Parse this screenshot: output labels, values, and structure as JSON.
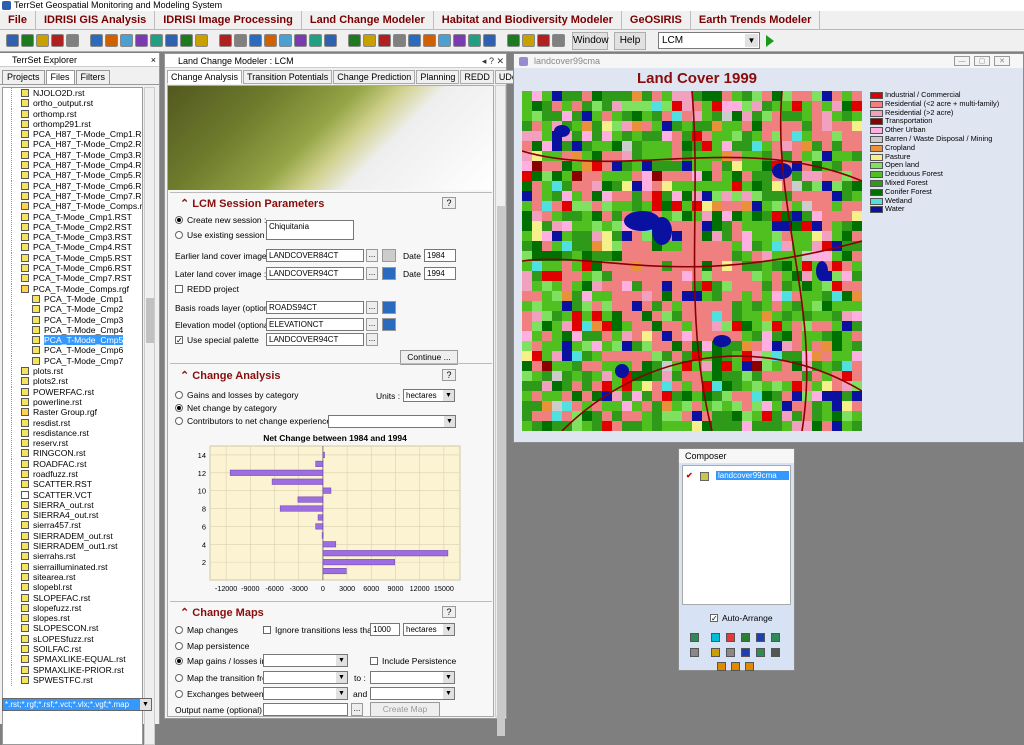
{
  "app": {
    "title": "TerrSet Geospatial Monitoring and Modeling System"
  },
  "menu": [
    "File",
    "IDRISI GIS Analysis",
    "IDRISI Image Processing",
    "Land Change Modeler",
    "Habitat and Biodiversity Modeler",
    "GeOSIRIS",
    "Earth Trends Modeler"
  ],
  "toolbar": {
    "window_label": "Window",
    "help_label": "Help",
    "module_select": "LCM"
  },
  "explorer": {
    "title": "TerrSet Explorer",
    "tabs": [
      "Projects",
      "Files",
      "Filters"
    ],
    "files": [
      {
        "name": "NJOLO2D.rst",
        "level": 1
      },
      {
        "name": "ortho_output.rst",
        "level": 1
      },
      {
        "name": "orthomp.rst",
        "level": 1
      },
      {
        "name": "orthomp291.rst",
        "level": 1
      },
      {
        "name": "PCA_H87_T-Mode_Cmp1.RST",
        "level": 1
      },
      {
        "name": "PCA_H87_T-Mode_Cmp2.RST",
        "level": 1
      },
      {
        "name": "PCA_H87_T-Mode_Cmp3.RST",
        "level": 1
      },
      {
        "name": "PCA_H87_T-Mode_Cmp4.RST",
        "level": 1
      },
      {
        "name": "PCA_H87_T-Mode_Cmp5.RST",
        "level": 1
      },
      {
        "name": "PCA_H87_T-Mode_Cmp6.RST",
        "level": 1
      },
      {
        "name": "PCA_H87_T-Mode_Cmp7.RST",
        "level": 1
      },
      {
        "name": "PCA_H87_T-Mode_Comps.rgf",
        "level": 1
      },
      {
        "name": "PCA_T-Mode_Cmp1.RST",
        "level": 1
      },
      {
        "name": "PCA_T-Mode_Cmp2.RST",
        "level": 1
      },
      {
        "name": "PCA_T-Mode_Cmp3.RST",
        "level": 1
      },
      {
        "name": "PCA_T-Mode_Cmp4.RST",
        "level": 1
      },
      {
        "name": "PCA_T-Mode_Cmp5.RST",
        "level": 1
      },
      {
        "name": "PCA_T-Mode_Cmp6.RST",
        "level": 1
      },
      {
        "name": "PCA_T-Mode_Cmp7.RST",
        "level": 1
      },
      {
        "name": "PCA_T-Mode_Comps.rgf",
        "level": 1
      },
      {
        "name": "PCA_T-Mode_Cmp1",
        "level": 2
      },
      {
        "name": "PCA_T-Mode_Cmp2",
        "level": 2
      },
      {
        "name": "PCA_T-Mode_Cmp3",
        "level": 2
      },
      {
        "name": "PCA_T-Mode_Cmp4",
        "level": 2
      },
      {
        "name": "PCA_T-Mode_Cmp5",
        "level": 2,
        "selected": true
      },
      {
        "name": "PCA_T-Mode_Cmp6",
        "level": 2
      },
      {
        "name": "PCA_T-Mode_Cmp7",
        "level": 2
      },
      {
        "name": "plots.rst",
        "level": 1
      },
      {
        "name": "plots2.rst",
        "level": 1
      },
      {
        "name": "POWERFAC.rst",
        "level": 1
      },
      {
        "name": "powerline.rst",
        "level": 1
      },
      {
        "name": "Raster Group.rgf",
        "level": 1
      },
      {
        "name": "resdist.rst",
        "level": 1
      },
      {
        "name": "resdistance.rst",
        "level": 1
      },
      {
        "name": "reserv.rst",
        "level": 1
      },
      {
        "name": "RINGCON.rst",
        "level": 1
      },
      {
        "name": "ROADFAC.rst",
        "level": 1
      },
      {
        "name": "roadfuzz.rst",
        "level": 1
      },
      {
        "name": "SCATTER.RST",
        "level": 1
      },
      {
        "name": "SCATTER.VCT",
        "level": 1
      },
      {
        "name": "SIERRA_out.rst",
        "level": 1
      },
      {
        "name": "SIERRA4_out.rst",
        "level": 1
      },
      {
        "name": "sierra457.rst",
        "level": 1
      },
      {
        "name": "SIERRADEM_out.rst",
        "level": 1
      },
      {
        "name": "SIERRADEM_out1.rst",
        "level": 1
      },
      {
        "name": "sierrahs.rst",
        "level": 1
      },
      {
        "name": "sierrailluminated.rst",
        "level": 1
      },
      {
        "name": "sitearea.rst",
        "level": 1
      },
      {
        "name": "slopebl.rst",
        "level": 1
      },
      {
        "name": "SLOPEFAC.rst",
        "level": 1
      },
      {
        "name": "slopefuzz.rst",
        "level": 1
      },
      {
        "name": "slopes.rst",
        "level": 1
      },
      {
        "name": "SLOPESCON.rst",
        "level": 1
      },
      {
        "name": "sLOPESfuzz.rst",
        "level": 1
      },
      {
        "name": "SOILFAC.rst",
        "level": 1
      },
      {
        "name": "SPMAXLIKE-EQUAL.rst",
        "level": 1
      },
      {
        "name": "SPMAXLIKE-PRIOR.rst",
        "level": 1
      },
      {
        "name": "SPWESTFC.rst",
        "level": 1
      }
    ],
    "filter": "*.rst;*.rgf;*.rsf;*.vct;*.vlx;*.vgf;*.map"
  },
  "lcm": {
    "title": "Land Change Modeler : LCM",
    "tabs": [
      "Change Analysis",
      "Transition Potentials",
      "Change Prediction",
      "Planning",
      "REDD",
      "UDel-A"
    ],
    "session": {
      "title": "LCM Session Parameters",
      "create_label": "Create new session :",
      "use_label": "Use existing session :",
      "session_name": "Chiquitania",
      "earlier_label": "Earlier land cover image :",
      "earlier_value": "LANDCOVER84CT",
      "later_label": "Later land cover image :",
      "later_value": "LANDCOVER94CT",
      "date_label": "Date :",
      "date1": "1984",
      "date2": "1994",
      "redd_label": "REDD project",
      "roads_label": "Basis roads layer (optional) :",
      "roads_value": "ROADS94CT",
      "elev_label": "Elevation model (optional) :",
      "elev_value": "ELEVATIONCT",
      "palette_label": "Use special palette",
      "palette_value": "LANDCOVER94CT",
      "continue_label": "Continue ..."
    },
    "change": {
      "title": "Change Analysis",
      "gains_label": "Gains and losses by category",
      "net_label": "Net change by category",
      "contrib_label": "Contributors to net change experienced by :",
      "units_label": "Units :",
      "units_value": "hectares",
      "chart_title": "Net Change between 1984 and 1994"
    },
    "maps": {
      "title": "Change Maps",
      "map_changes": "Map changes",
      "ignore_label": "Ignore transitions less than",
      "ignore_value": "1000",
      "ignore_units": "hectares",
      "persistence": "Map persistence",
      "gains_losses": "Map gains / losses in :",
      "include_persist": "Include Persistence",
      "transition_from": "Map the transition from :",
      "to_label": "to :",
      "exchanges": "Exchanges between :",
      "and_label": "and",
      "output_label": "Output name (optional) :",
      "create_label": "Create Map"
    }
  },
  "chart_data": {
    "type": "bar",
    "orientation": "horizontal",
    "title": "Net Change between 1984 and 1994",
    "y": [
      1,
      2,
      3,
      4,
      5,
      6,
      7,
      8,
      9,
      10,
      11,
      12,
      13,
      14
    ],
    "values": [
      2900,
      8900,
      15500,
      1600,
      -100,
      -900,
      -600,
      -5300,
      -3100,
      1000,
      -6300,
      -11500,
      -900,
      200
    ],
    "xlim": [
      -14000,
      17000
    ],
    "xticks": [
      -12000,
      -9000,
      -6000,
      -3000,
      0,
      3000,
      6000,
      9000,
      12000,
      15000
    ],
    "ylim": [
      0,
      15
    ],
    "yticks": [
      2,
      4,
      6,
      8,
      10,
      12,
      14
    ],
    "bar_color": "#9c6ee0",
    "background": "#fbf3d2"
  },
  "map": {
    "window_title": "landcover99cma",
    "title": "Land Cover 1999",
    "legend": [
      {
        "label": "Industrial / Commercial",
        "color": "#e00000"
      },
      {
        "label": "Residential (<2 acre + multi-family)",
        "color": "#f08080"
      },
      {
        "label": "Residential (>2 acre)",
        "color": "#f2a0c0"
      },
      {
        "label": "Transportation",
        "color": "#8b0000"
      },
      {
        "label": "Other Urban",
        "color": "#ffb0e0"
      },
      {
        "label": "Barren / Waste Disposal / Mining",
        "color": "#cccccc"
      },
      {
        "label": "Cropland",
        "color": "#e8913a"
      },
      {
        "label": "Pasture",
        "color": "#f5f08a"
      },
      {
        "label": "Open land",
        "color": "#80e060"
      },
      {
        "label": "Deciduous Forest",
        "color": "#50c020"
      },
      {
        "label": "Mixed Forest",
        "color": "#2f9a1a"
      },
      {
        "label": "Conifer Forest",
        "color": "#007000"
      },
      {
        "label": "Wetland",
        "color": "#50e0e0"
      },
      {
        "label": "Water",
        "color": "#0a10a0"
      }
    ]
  },
  "composer": {
    "title": "Composer",
    "layer": "landcover99cma",
    "auto_arrange": "Auto-Arrange"
  }
}
